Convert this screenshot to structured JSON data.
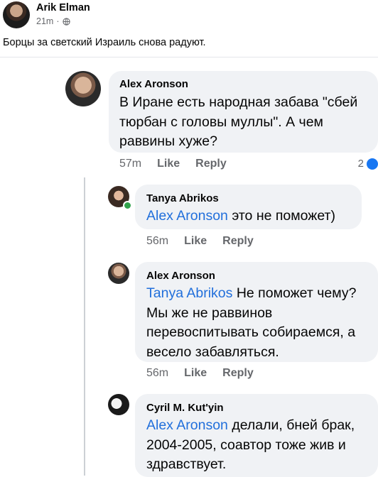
{
  "post": {
    "author": "Arik Elman",
    "time": "21m",
    "sep": "·",
    "text": "Борцы за светский Израиль снова радуют."
  },
  "comments": [
    {
      "name": "Alex Aronson",
      "mention": "",
      "text": "В Иране есть народная забава \"сбей тюрбан с головы муллы\". А чем раввины хуже?",
      "time": "57m",
      "like": "Like",
      "reply": "Reply",
      "reactions": "2"
    },
    {
      "name": "Tanya Abrikos",
      "mention": "Alex Aronson",
      "text": " это не поможет)",
      "time": "56m",
      "like": "Like",
      "reply": "Reply"
    },
    {
      "name": "Alex Aronson",
      "mention": "Tanya Abrikos",
      "text": " Не поможет чему? Мы же не раввинов перевоспитывать собираемся, а весело забавляться.",
      "time": "56m",
      "like": "Like",
      "reply": "Reply"
    },
    {
      "name": "Cyril M. Kut'yin",
      "mention": "Alex Aronson",
      "text": " делали, бней брак, 2004-2005, соавтор тоже жив и здравствует.",
      "time": "",
      "like": "",
      "reply": ""
    }
  ]
}
